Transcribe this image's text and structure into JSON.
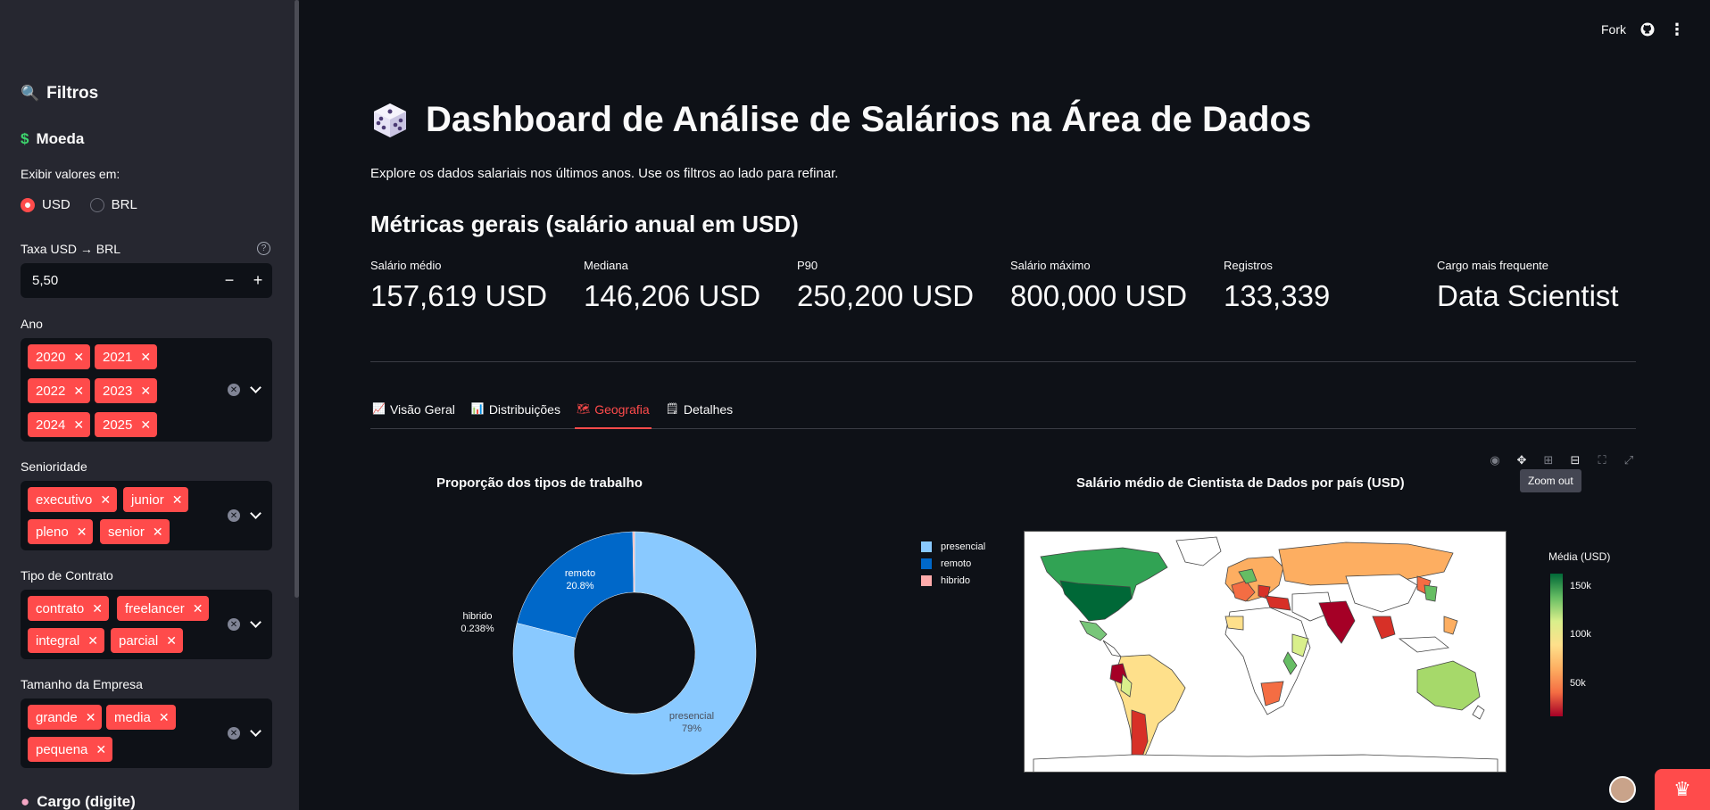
{
  "sidebar": {
    "filters_title": "Filtros",
    "filters_icon": "magnifier-icon",
    "currency_title": "Moeda",
    "currency_icon": "dollar-icon",
    "show_values_label": "Exibir valores em:",
    "currency_options": [
      "USD",
      "BRL"
    ],
    "currency_selected": "USD",
    "rate_label": "Taxa USD → BRL",
    "rate_value": "5,50",
    "year_label": "Ano",
    "years": [
      "2020",
      "2021",
      "2022",
      "2023",
      "2024",
      "2025"
    ],
    "seniority_label": "Senioridade",
    "seniority": [
      "executivo",
      "junior",
      "pleno",
      "senior"
    ],
    "contract_label": "Tipo de Contrato",
    "contracts": [
      "contrato",
      "freelancer",
      "integral",
      "parcial"
    ],
    "company_size_label": "Tamanho da Empresa",
    "company_sizes": [
      "grande",
      "media",
      "pequena"
    ],
    "cargo_label": "Cargo (digite)",
    "cargo_icon": "brain-icon"
  },
  "topbar": {
    "fork_label": "Fork"
  },
  "header": {
    "title": "Dashboard de Análise de Salários na Área de Dados",
    "title_icon": "dice-icon",
    "subtitle": "Explore os dados salariais nos últimos anos. Use os filtros ao lado para refinar.",
    "metrics_title": "Métricas gerais (salário anual em USD)"
  },
  "metrics": [
    {
      "label": "Salário médio",
      "value": "157,619 USD"
    },
    {
      "label": "Mediana",
      "value": "146,206 USD"
    },
    {
      "label": "P90",
      "value": "250,200 USD"
    },
    {
      "label": "Salário máximo",
      "value": "800,000 USD"
    },
    {
      "label": "Registros",
      "value": "133,339"
    },
    {
      "label": "Cargo mais frequente",
      "value": "Data Scientist"
    }
  ],
  "tabs": [
    {
      "label": "Visão Geral",
      "icon": "chart-up-icon"
    },
    {
      "label": "Distribuições",
      "icon": "bar-chart-icon"
    },
    {
      "label": "Geografia",
      "icon": "map-icon"
    },
    {
      "label": "Detalhes",
      "icon": "notepad-icon"
    }
  ],
  "active_tab": "Geografia",
  "modebar_tooltip": "Zoom out",
  "colors": {
    "accent": "#ff4b4b",
    "sidebar_bg": "#262730",
    "main_bg": "#0e1117"
  },
  "chart_data": [
    {
      "type": "pie",
      "title": "Proporção dos tipos de trabalho",
      "hole": true,
      "categories": [
        "presencial",
        "remoto",
        "hibrido"
      ],
      "values": [
        79,
        20.8,
        0.238
      ],
      "labels": [
        "79%",
        "20.8%",
        "0.238%"
      ],
      "colors": [
        "#89c9ff",
        "#0068c9",
        "#ffabab"
      ]
    },
    {
      "type": "heatmap",
      "title": "Salário médio de Cientista de Dados por país (USD)",
      "colorbar_title": "Média (USD)",
      "colorbar_ticks": [
        "150k",
        "100k",
        "50k"
      ],
      "colorscale": "RdYlGn"
    }
  ]
}
